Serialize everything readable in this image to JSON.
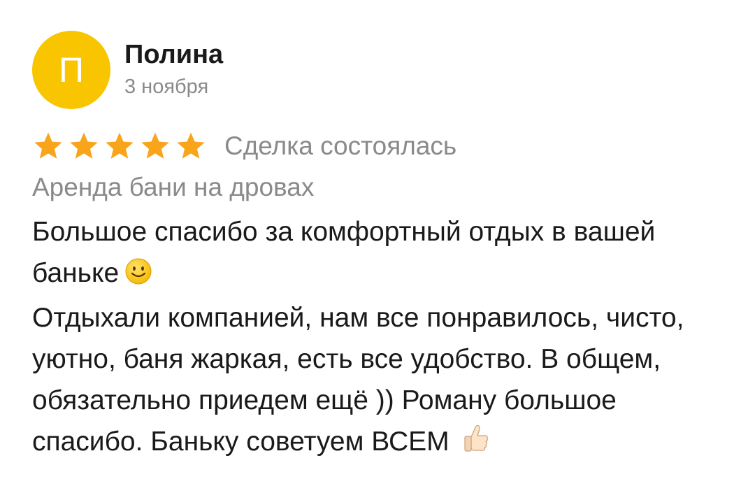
{
  "review": {
    "avatar_letter": "П",
    "author": "Полина",
    "date": "3 ноября",
    "rating": 5,
    "rating_max": 5,
    "star_color": "#f8a51c",
    "avatar_color": "#f8c500",
    "deal_status": "Сделка состоялась",
    "category": "Аренда бани на дровах",
    "text_part1": "Большое спасибо за комфортный отдых в вашей баньке",
    "emoji1": "slightly-smiling-face-icon",
    "text_part2": "Отдыхали компанией, нам все понравилось, чисто, уютно,  баня жаркая, есть все удобство. В общем, обязательно приедем ещё )) Роману большое спасибо. Баньку советуем ВСЕМ",
    "emoji2": "thumbs-up-icon"
  }
}
